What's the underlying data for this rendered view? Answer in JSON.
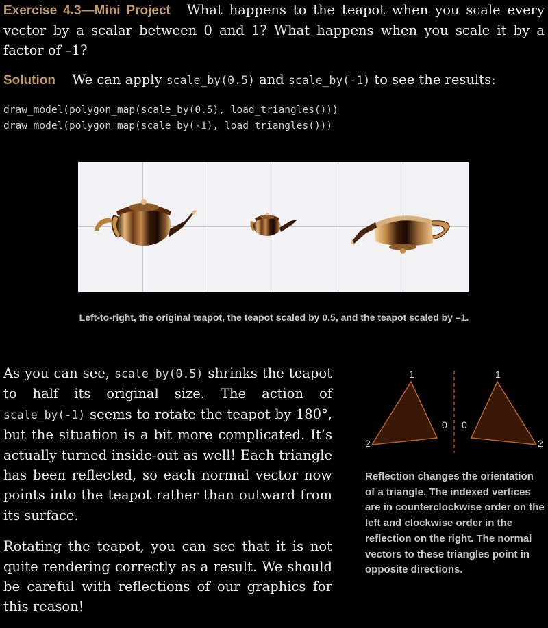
{
  "exercise": {
    "label": "Exercise 4.3—Mini Project",
    "text": "What happens to the teapot when you scale every vector by a scalar between 0 and 1? What happens when you scale it by a factor of –1?"
  },
  "solution": {
    "label": "Solution",
    "text_before": "We can apply",
    "code1": "scale_by(0.5)",
    "text_mid": "and",
    "code2": "scale_by(-1)",
    "text_after": "to see the results:"
  },
  "code_block": {
    "line1": "draw_model(polygon_map(scale_by(0.5), load_triangles()))",
    "line2": "draw_model(polygon_map(scale_by(-1), load_triangles()))"
  },
  "figure": {
    "caption": "Left-to-right, the original teapot, the teapot scaled by 0.5, and the teapot scaled by –1.",
    "panels": [
      "original teapot",
      "teapot scaled by 0.5",
      "teapot scaled by –1"
    ]
  },
  "body": {
    "p1_pre": "As you can see,",
    "p1_code1": "scale_by(0.5)",
    "p1_mid": "shrinks the teapot to half its original size. The action of",
    "p1_code2": "scale_by(-1)",
    "p1_post": "seems to rotate the teapot by 180°, but the situation is a bit more complicated. It’s actually turned inside-out as well! Each triangle has been reflected, so each normal vector now points into the teapot rather than outward from its surface.",
    "p2": "Rotating the teapot, you can see that it is not quite rendering correctly as a result. We should be careful with reflections of our graphics for this reason!"
  },
  "triangle_figure": {
    "left_labels": [
      "1",
      "0",
      "2"
    ],
    "right_labels": [
      "1",
      "0",
      "2"
    ],
    "caption": "Reflection changes the orientation of a triangle. The indexed vertices are in counterclockwise order on the left and clockwise order in the reflection on the right. The normal vectors to these triangles point in opposite directions.",
    "colors": {
      "fill": "#3a1808",
      "stroke": "#b8612a",
      "axis": "#d03a2a"
    }
  }
}
